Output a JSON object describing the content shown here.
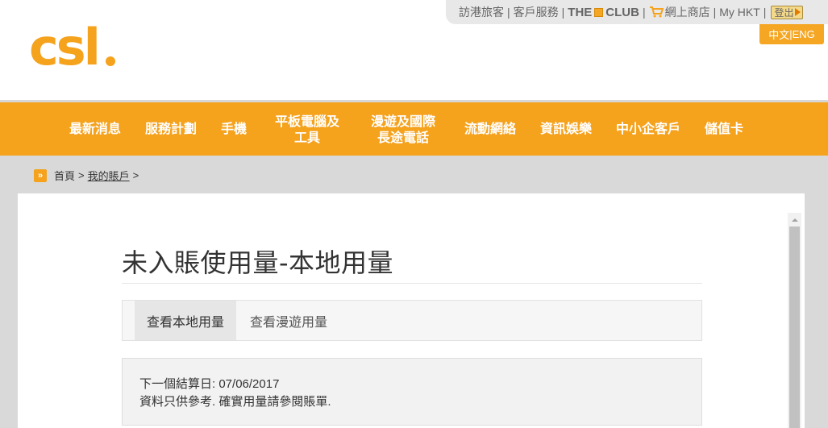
{
  "logo": {
    "text": "csl.",
    "color": "#f5a21d"
  },
  "utility": {
    "visitors": "訪港旅客",
    "customer_service": "客戶服務",
    "club_prefix": "THE",
    "club_suffix": "CLUB",
    "online_shop": "網上商店",
    "my_hkt": "My HKT",
    "logout": "登出",
    "separator": "|"
  },
  "language": {
    "zh": "中文",
    "sep": "|",
    "en": "ENG"
  },
  "nav": {
    "items": [
      {
        "label": "最新消息"
      },
      {
        "label": "服務計劃"
      },
      {
        "label": "手機"
      },
      {
        "label_line1": "平板電腦及",
        "label_line2": "工具"
      },
      {
        "label_line1": "漫遊及國際",
        "label_line2": "長途電話"
      },
      {
        "label": "流動網絡"
      },
      {
        "label": "資訊娛樂"
      },
      {
        "label": "中小企客戶"
      },
      {
        "label": "儲值卡"
      }
    ]
  },
  "breadcrumb": {
    "icon": "»",
    "home": "首頁",
    "sep1": ">",
    "account": "我的賬戶",
    "sep2": ">"
  },
  "main": {
    "title": "未入賬使用量-本地用量",
    "tabs": [
      {
        "label": "查看本地用量",
        "active": true
      },
      {
        "label": "查看漫遊用量",
        "active": false
      }
    ],
    "info": {
      "next_billing": "下一個結算日: 07/06/2017",
      "disclaimer": "資料只供參考. 確實用量請參閱賬單."
    }
  },
  "colors": {
    "brand_orange": "#f5a21d",
    "club_blue": "#123f7a"
  }
}
